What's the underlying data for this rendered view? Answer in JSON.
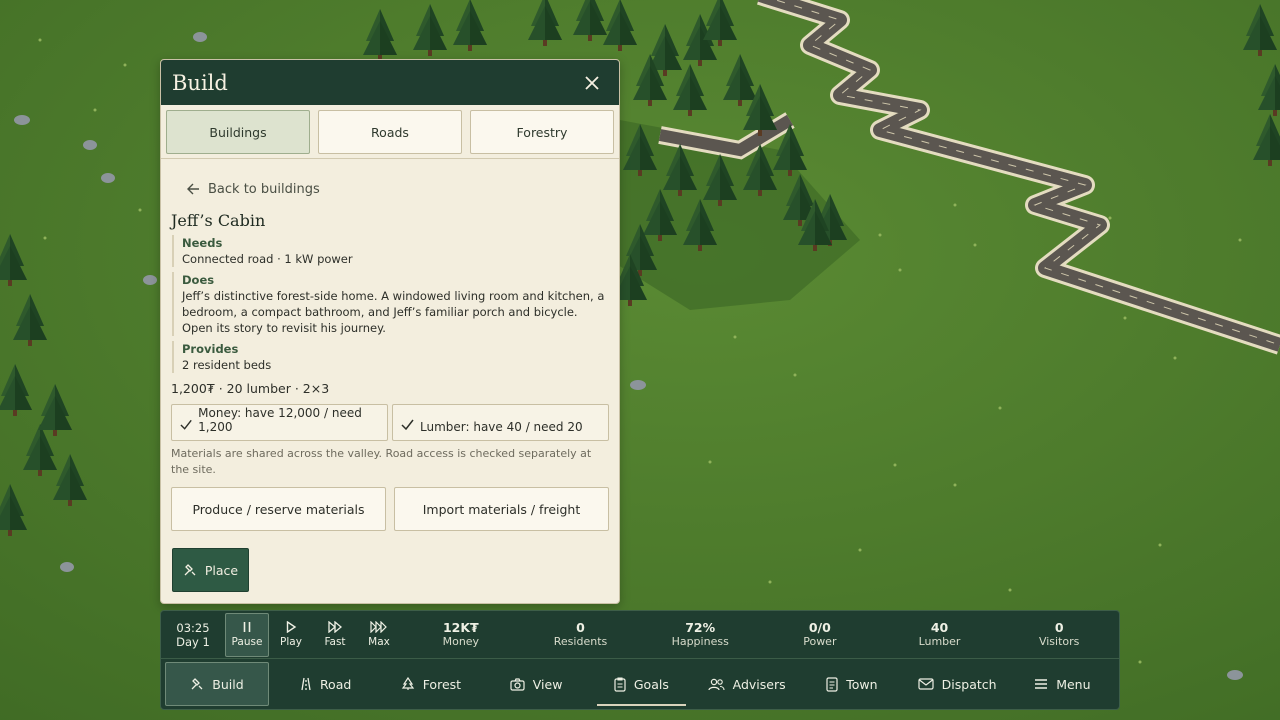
{
  "panel": {
    "title": "Build",
    "tabs": [
      {
        "label": "Buildings",
        "active": true
      },
      {
        "label": "Roads",
        "active": false
      },
      {
        "label": "Forestry",
        "active": false
      }
    ],
    "back_label": "Back to buildings",
    "building": {
      "name": "Jeff’s Cabin",
      "needs_label": "Needs",
      "needs_text": "Connected road · 1 kW power",
      "does_label": "Does",
      "does_text": "Jeff’s distinctive forest-side home. A windowed living room and kitchen, a bedroom, a compact bathroom, and Jeff’s familiar porch and bicycle. Open its story to revisit his journey.",
      "provides_label": "Provides",
      "provides_text": "2 resident beds",
      "cost_line": "1,200₮ · 20 lumber · 2×3"
    },
    "requirements": [
      {
        "text": "Money: have 12,000 / need 1,200",
        "met": true
      },
      {
        "text": "Lumber: have 40 / need 20",
        "met": true
      }
    ],
    "note": "Materials are shared across the valley. Road access is checked separately at the site.",
    "actions": {
      "produce": "Produce / reserve materials",
      "import": "Import materials / freight",
      "place": "Place"
    }
  },
  "bottom_bar": {
    "clock": {
      "time": "03:25",
      "day": "Day 1"
    },
    "speed": [
      {
        "label": "Pause",
        "icon": "pause-icon",
        "active": true
      },
      {
        "label": "Play",
        "icon": "play-icon",
        "active": false
      },
      {
        "label": "Fast",
        "icon": "fast-forward-icon",
        "active": false
      },
      {
        "label": "Max",
        "icon": "max-speed-icon",
        "active": false
      }
    ],
    "stats": [
      {
        "value": "12K₮",
        "label": "Money"
      },
      {
        "value": "0",
        "label": "Residents"
      },
      {
        "value": "72%",
        "label": "Happiness"
      },
      {
        "value": "0/0",
        "label": "Power"
      },
      {
        "value": "40",
        "label": "Lumber"
      },
      {
        "value": "0",
        "label": "Visitors"
      }
    ],
    "nav": [
      {
        "label": "Build",
        "icon": "build-icon"
      },
      {
        "label": "Road",
        "icon": "road-icon"
      },
      {
        "label": "Forest",
        "icon": "tree-icon"
      },
      {
        "label": "View",
        "icon": "camera-icon"
      },
      {
        "label": "Goals",
        "icon": "clipboard-icon"
      },
      {
        "label": "Advisers",
        "icon": "people-icon"
      },
      {
        "label": "Town",
        "icon": "document-icon"
      },
      {
        "label": "Dispatch",
        "icon": "mail-icon"
      },
      {
        "label": "Menu",
        "icon": "menu-icon"
      }
    ]
  },
  "colors": {
    "panel_header": "#1f3d30",
    "panel_bg": "#f3eede",
    "grass": "#4f7a2c",
    "tree": "#2c4f2a",
    "road": "#5b5650"
  }
}
